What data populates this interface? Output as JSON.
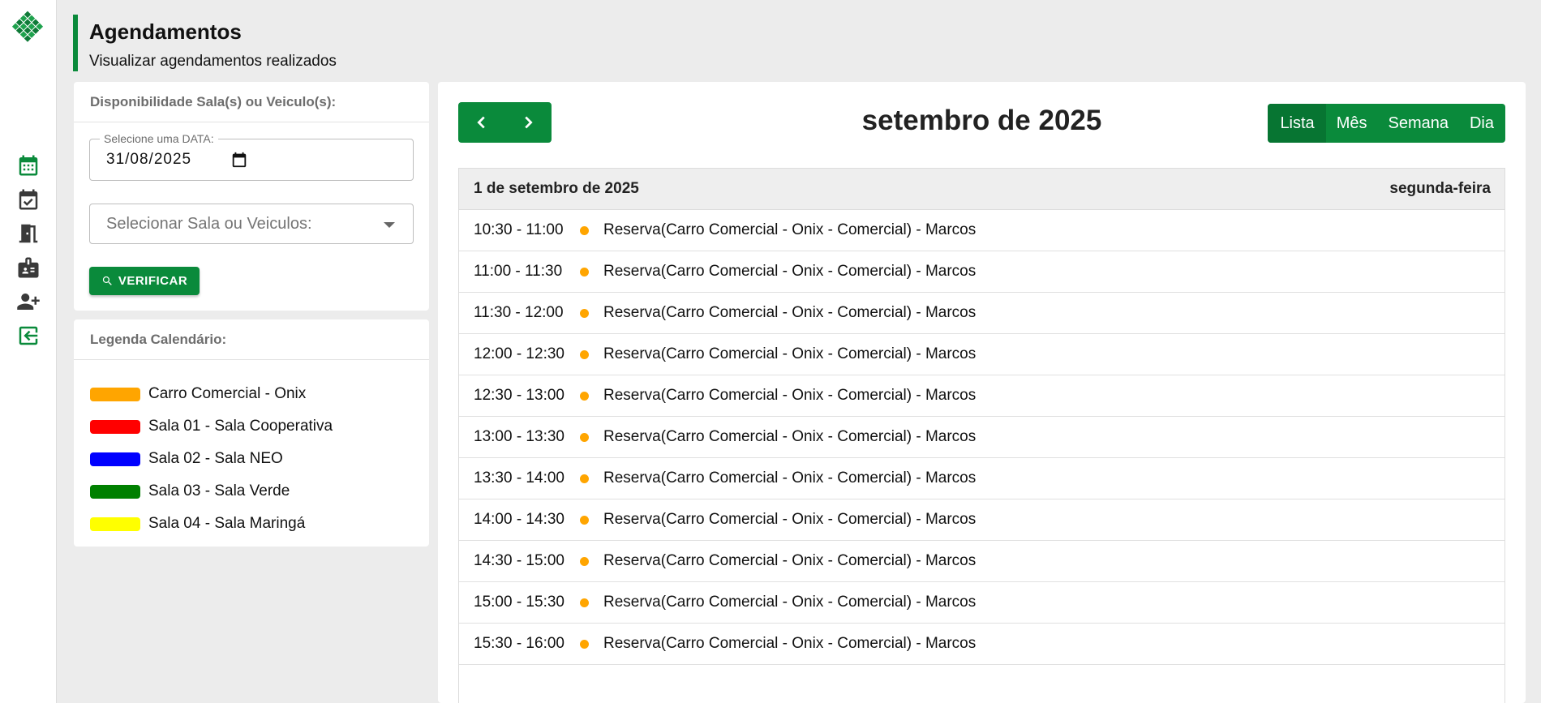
{
  "header": {
    "title": "Agendamentos",
    "subtitle": "Visualizar agendamentos realizados"
  },
  "sidebar": {
    "items": [
      {
        "icon": "calendar-icon",
        "color": "#0a8a3b"
      },
      {
        "icon": "calendar-check-icon",
        "color": "#3a3a3a"
      },
      {
        "icon": "door-icon",
        "color": "#3a3a3a"
      },
      {
        "icon": "badge-icon",
        "color": "#3a3a3a"
      },
      {
        "icon": "add-user-icon",
        "color": "#3a3a3a"
      },
      {
        "icon": "logout-icon",
        "color": "#0a8a3b"
      }
    ]
  },
  "availability": {
    "title": "Disponibilidade Sala(s) ou Veiculo(s):",
    "date_label": "Selecione uma DATA:",
    "date_value": "31/08/2025",
    "select_placeholder": "Selecionar Sala ou Veiculos:",
    "verify_label": "VERIFICAR"
  },
  "legend": {
    "title": "Legenda Calendário:",
    "items": [
      {
        "label": "Carro Comercial - Onix",
        "color": "#ffa500"
      },
      {
        "label": "Sala 01 - Sala Cooperativa",
        "color": "#ff0000"
      },
      {
        "label": "Sala 02 - Sala NEO",
        "color": "#0000ff"
      },
      {
        "label": "Sala 03 - Sala Verde",
        "color": "#008000"
      },
      {
        "label": "Sala 04 - Sala Maringá",
        "color": "#ffff00"
      }
    ]
  },
  "calendar": {
    "title": "setembro de 2025",
    "views": [
      "Lista",
      "Mês",
      "Semana",
      "Dia"
    ],
    "active_view": "Lista",
    "day_date": "1 de setembro de 2025",
    "day_name": "segunda-feira",
    "events": [
      {
        "time": "10:30 - 11:00",
        "title": "Reserva(Carro Comercial - Onix - Comercial) - Marcos",
        "color": "#ffa500"
      },
      {
        "time": "11:00 - 11:30",
        "title": "Reserva(Carro Comercial - Onix - Comercial) - Marcos",
        "color": "#ffa500"
      },
      {
        "time": "11:30 - 12:00",
        "title": "Reserva(Carro Comercial - Onix - Comercial) - Marcos",
        "color": "#ffa500"
      },
      {
        "time": "12:00 - 12:30",
        "title": "Reserva(Carro Comercial - Onix - Comercial) - Marcos",
        "color": "#ffa500"
      },
      {
        "time": "12:30 - 13:00",
        "title": "Reserva(Carro Comercial - Onix - Comercial) - Marcos",
        "color": "#ffa500"
      },
      {
        "time": "13:00 - 13:30",
        "title": "Reserva(Carro Comercial - Onix - Comercial) - Marcos",
        "color": "#ffa500"
      },
      {
        "time": "13:30 - 14:00",
        "title": "Reserva(Carro Comercial - Onix - Comercial) - Marcos",
        "color": "#ffa500"
      },
      {
        "time": "14:00 - 14:30",
        "title": "Reserva(Carro Comercial - Onix - Comercial) - Marcos",
        "color": "#ffa500"
      },
      {
        "time": "14:30 - 15:00",
        "title": "Reserva(Carro Comercial - Onix - Comercial) - Marcos",
        "color": "#ffa500"
      },
      {
        "time": "15:00 - 15:30",
        "title": "Reserva(Carro Comercial - Onix - Comercial) - Marcos",
        "color": "#ffa500"
      },
      {
        "time": "15:30 - 16:00",
        "title": "Reserva(Carro Comercial - Onix - Comercial) - Marcos",
        "color": "#ffa500"
      }
    ]
  },
  "colors": {
    "brand": "#0a8a3b",
    "brand_dark": "#077532"
  }
}
